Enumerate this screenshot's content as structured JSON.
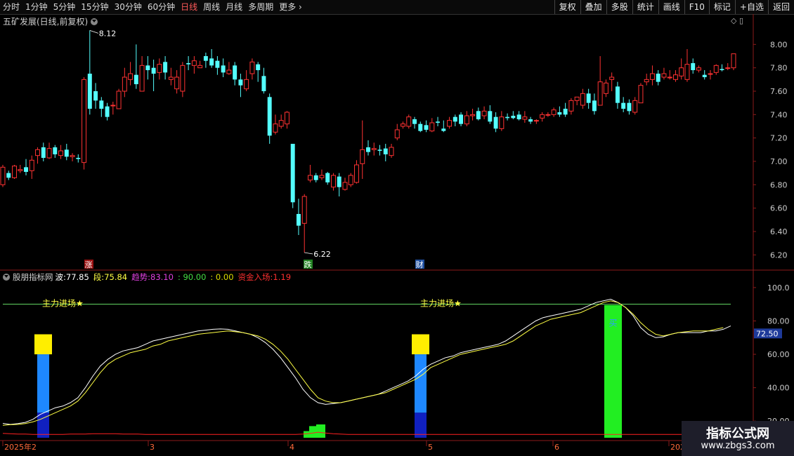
{
  "toolbar": {
    "left_items": [
      "分时",
      "1分钟",
      "5分钟",
      "15分钟",
      "30分钟",
      "60分钟",
      "日线",
      "周线",
      "月线",
      "多周期",
      "更多"
    ],
    "active": "日线",
    "right_buttons": [
      "复权",
      "叠加",
      "多股",
      "统计",
      "画线",
      "F10",
      "标记",
      "+自选",
      "返回"
    ]
  },
  "stock_title": "五矿发展(日线,前复权)",
  "mode_icons": "◇ ▯",
  "indicator": {
    "name": "股朋指标网",
    "bo_label": "波:",
    "bo_value": "77.85",
    "duan_label": "段:",
    "duan_value": "75.84",
    "qushi_label": "趋势:",
    "qushi_value": "83.10",
    "v90": ": 90.00",
    "v0": ": 0.00",
    "zijin_label": "资金入场:",
    "zijin_value": "1.19"
  },
  "logo": {
    "title": "指标公式网",
    "url": "www.zbgs3.com"
  },
  "chart_data": [
    {
      "type": "candlestick",
      "title": "五矿发展(日线,前复权)",
      "ylim": [
        6.1,
        8.2
      ],
      "yticks": [
        "8.00",
        "7.80",
        "7.60",
        "7.40",
        "7.20",
        "7.00",
        "6.80",
        "6.60",
        "6.40",
        "6.20"
      ],
      "yvalues": [
        8.0,
        7.8,
        7.6,
        7.4,
        7.2,
        7.0,
        6.8,
        6.6,
        6.4,
        6.2
      ],
      "annotations": {
        "high": "8.12",
        "low": "6.22"
      },
      "markers": [
        "涨",
        "跌",
        "财"
      ],
      "candles": [
        [
          6.8,
          6.95,
          6.78,
          6.97
        ],
        [
          6.9,
          6.86,
          6.84,
          6.92
        ],
        [
          6.86,
          6.96,
          6.85,
          6.97
        ],
        [
          6.92,
          6.93,
          6.9,
          6.97
        ],
        [
          6.95,
          6.91,
          6.88,
          7.02
        ],
        [
          6.92,
          7.01,
          6.85,
          7.05
        ],
        [
          7.05,
          7.1,
          6.98,
          7.12
        ],
        [
          7.12,
          7.03,
          7.0,
          7.16
        ],
        [
          7.03,
          7.11,
          7.02,
          7.16
        ],
        [
          7.12,
          7.06,
          7.03,
          7.14
        ],
        [
          7.05,
          7.09,
          7.02,
          7.14
        ],
        [
          7.1,
          7.04,
          7.01,
          7.15
        ],
        [
          7.04,
          7.05,
          7.0,
          7.07
        ],
        [
          7.03,
          7.02,
          6.99,
          7.06
        ],
        [
          6.99,
          7.7,
          6.93,
          7.72
        ],
        [
          7.75,
          7.45,
          7.4,
          8.12
        ],
        [
          7.6,
          7.52,
          7.45,
          7.67
        ],
        [
          7.52,
          7.45,
          7.38,
          7.55
        ],
        [
          7.47,
          7.38,
          7.35,
          7.5
        ],
        [
          7.48,
          7.48,
          7.4,
          7.51
        ],
        [
          7.45,
          7.6,
          7.45,
          7.62
        ],
        [
          7.6,
          7.72,
          7.55,
          7.8
        ],
        [
          7.7,
          7.75,
          7.65,
          7.85
        ],
        [
          7.74,
          7.66,
          7.62,
          8.0
        ],
        [
          7.6,
          7.82,
          7.6,
          7.9
        ],
        [
          7.82,
          7.78,
          7.7,
          7.9
        ],
        [
          7.8,
          7.75,
          7.6,
          7.87
        ],
        [
          7.76,
          7.83,
          7.7,
          7.88
        ],
        [
          7.85,
          7.76,
          7.7,
          7.9
        ],
        [
          7.7,
          7.72,
          7.65,
          7.8
        ],
        [
          7.62,
          7.72,
          7.58,
          7.78
        ],
        [
          7.6,
          7.82,
          7.55,
          7.85
        ],
        [
          7.84,
          7.83,
          7.78,
          7.9
        ],
        [
          7.82,
          7.86,
          7.75,
          7.9
        ],
        [
          7.8,
          7.82,
          7.8,
          7.86
        ],
        [
          7.9,
          7.86,
          7.8,
          7.93
        ],
        [
          7.88,
          7.82,
          7.8,
          7.96
        ],
        [
          7.86,
          7.8,
          7.74,
          7.9
        ],
        [
          7.82,
          7.76,
          7.72,
          7.88
        ],
        [
          7.75,
          7.78,
          7.74,
          7.85
        ],
        [
          7.82,
          7.7,
          7.65,
          7.85
        ],
        [
          7.7,
          7.65,
          7.55,
          7.75
        ],
        [
          7.62,
          7.7,
          7.6,
          7.78
        ],
        [
          7.75,
          7.85,
          7.7,
          7.88
        ],
        [
          7.83,
          7.78,
          7.68,
          7.85
        ],
        [
          7.73,
          7.6,
          7.58,
          7.8
        ],
        [
          7.55,
          7.22,
          7.15,
          7.58
        ],
        [
          7.25,
          7.32,
          7.23,
          7.4
        ],
        [
          7.3,
          7.35,
          7.28,
          7.4
        ],
        [
          7.32,
          7.42,
          7.28,
          7.43
        ],
        [
          7.15,
          6.65,
          6.6,
          7.15
        ],
        [
          6.55,
          6.45,
          6.37,
          6.68
        ],
        [
          6.47,
          6.7,
          6.22,
          6.72
        ],
        [
          6.84,
          6.88,
          6.82,
          6.97
        ],
        [
          6.88,
          6.84,
          6.82,
          6.9
        ],
        [
          6.86,
          6.88,
          6.84,
          6.93
        ],
        [
          6.9,
          6.82,
          6.8,
          6.91
        ],
        [
          6.78,
          6.88,
          6.75,
          6.9
        ],
        [
          6.87,
          6.78,
          6.7,
          6.9
        ],
        [
          6.76,
          6.82,
          6.75,
          6.86
        ],
        [
          6.8,
          6.88,
          6.78,
          6.9
        ],
        [
          6.82,
          6.97,
          6.81,
          7.01
        ],
        [
          6.98,
          7.1,
          6.85,
          7.35
        ],
        [
          7.12,
          7.08,
          7.05,
          7.18
        ],
        [
          7.1,
          7.11,
          7.05,
          7.16
        ],
        [
          7.1,
          7.09,
          7.05,
          7.14
        ],
        [
          7.11,
          7.06,
          7.0,
          7.15
        ],
        [
          7.05,
          7.12,
          7.03,
          7.15
        ],
        [
          7.2,
          7.27,
          7.18,
          7.32
        ],
        [
          7.3,
          7.32,
          7.28,
          7.34
        ],
        [
          7.3,
          7.38,
          7.28,
          7.4
        ],
        [
          7.36,
          7.32,
          7.28,
          7.38
        ],
        [
          7.32,
          7.26,
          7.25,
          7.34
        ],
        [
          7.31,
          7.27,
          7.25,
          7.35
        ],
        [
          7.26,
          7.33,
          7.25,
          7.37
        ],
        [
          7.34,
          7.33,
          7.3,
          7.38
        ],
        [
          7.28,
          7.26,
          7.25,
          7.35
        ],
        [
          7.3,
          7.35,
          7.28,
          7.38
        ],
        [
          7.38,
          7.34,
          7.3,
          7.4
        ],
        [
          7.4,
          7.32,
          7.3,
          7.42
        ],
        [
          7.32,
          7.39,
          7.3,
          7.43
        ],
        [
          7.39,
          7.4,
          7.35,
          7.45
        ],
        [
          7.43,
          7.36,
          7.35,
          7.46
        ],
        [
          7.39,
          7.43,
          7.36,
          7.47
        ],
        [
          7.43,
          7.34,
          7.32,
          7.48
        ],
        [
          7.38,
          7.28,
          7.25,
          7.42
        ],
        [
          7.28,
          7.38,
          7.26,
          7.43
        ],
        [
          7.38,
          7.37,
          7.35,
          7.41
        ],
        [
          7.39,
          7.37,
          7.36,
          7.43
        ],
        [
          7.4,
          7.36,
          7.35,
          7.43
        ],
        [
          7.36,
          7.38,
          7.33,
          7.43
        ],
        [
          7.36,
          7.34,
          7.32,
          7.38
        ],
        [
          7.35,
          7.35,
          7.32,
          7.36
        ],
        [
          7.37,
          7.4,
          7.34,
          7.42
        ],
        [
          7.4,
          7.4,
          7.38,
          7.42
        ],
        [
          7.4,
          7.44,
          7.38,
          7.46
        ],
        [
          7.42,
          7.4,
          7.38,
          7.47
        ],
        [
          7.45,
          7.4,
          7.38,
          7.5
        ],
        [
          7.43,
          7.52,
          7.4,
          7.54
        ],
        [
          7.52,
          7.55,
          7.48,
          7.55
        ],
        [
          7.48,
          7.58,
          7.45,
          7.62
        ],
        [
          7.58,
          7.5,
          7.45,
          7.62
        ],
        [
          7.52,
          7.43,
          7.4,
          7.58
        ],
        [
          7.48,
          7.68,
          7.48,
          7.9
        ],
        [
          7.58,
          7.67,
          7.55,
          7.7
        ],
        [
          7.7,
          7.72,
          7.6,
          7.76
        ],
        [
          7.64,
          7.5,
          7.45,
          7.68
        ],
        [
          7.5,
          7.45,
          7.42,
          7.55
        ],
        [
          7.5,
          7.43,
          7.4,
          7.53
        ],
        [
          7.42,
          7.52,
          7.4,
          7.55
        ],
        [
          7.5,
          7.65,
          7.5,
          7.67
        ],
        [
          7.68,
          7.7,
          7.65,
          7.75
        ],
        [
          7.7,
          7.75,
          7.65,
          7.82
        ],
        [
          7.75,
          7.68,
          7.65,
          7.78
        ],
        [
          7.72,
          7.75,
          7.7,
          7.8
        ],
        [
          7.72,
          7.72,
          7.7,
          7.78
        ],
        [
          7.7,
          7.74,
          7.68,
          7.78
        ],
        [
          7.73,
          7.8,
          7.7,
          7.88
        ],
        [
          7.7,
          7.83,
          7.68,
          7.96
        ],
        [
          7.84,
          7.78,
          7.75,
          7.88
        ],
        [
          7.78,
          7.8,
          7.76,
          7.82
        ],
        [
          7.74,
          7.72,
          7.7,
          7.78
        ],
        [
          7.75,
          7.75,
          7.7,
          7.78
        ],
        [
          7.76,
          7.82,
          7.74,
          7.83
        ],
        [
          7.79,
          7.78,
          7.77,
          7.83
        ],
        [
          7.8,
          7.8,
          7.78,
          7.84
        ],
        [
          7.8,
          7.92,
          7.78,
          7.92
        ]
      ]
    },
    {
      "type": "line",
      "title": "股朋指标网",
      "ylim": [
        10,
        105
      ],
      "yticks": [
        "100.0",
        "80.00",
        "60.00",
        "40.00",
        "20.00"
      ],
      "yvalues": [
        100,
        80,
        60,
        40,
        20
      ],
      "current_label": "72.50",
      "series": [
        {
          "name": "波",
          "color": "#ffffff",
          "values": [
            18.6,
            18.0,
            18.5,
            19.2,
            21,
            24,
            26,
            28,
            29,
            31,
            34,
            40,
            47,
            53,
            57,
            60,
            62,
            63,
            64,
            66,
            68,
            69,
            70,
            71,
            72,
            73,
            74,
            74.5,
            75,
            75.2,
            75,
            74,
            73,
            72,
            70,
            67,
            63,
            58,
            52,
            46,
            39,
            34,
            31,
            30,
            30.5,
            31,
            32,
            33,
            34,
            35,
            36,
            38,
            40,
            42,
            44,
            47,
            51,
            54,
            56,
            58,
            59,
            61,
            62,
            63,
            64,
            65,
            66,
            68,
            71,
            74,
            77,
            80,
            82,
            83,
            84,
            85,
            86,
            87,
            89,
            91,
            92,
            93,
            91,
            88,
            83,
            76,
            72,
            70,
            70.5,
            72,
            73,
            73,
            73,
            73,
            74,
            74,
            75,
            77
          ]
        },
        {
          "name": "段",
          "color": "#ffff44",
          "values": [
            17.5,
            17.8,
            18,
            18.5,
            19.5,
            21,
            23,
            25,
            27,
            29,
            32,
            37,
            43,
            49,
            54,
            57,
            59,
            61,
            62,
            63,
            65,
            66,
            68,
            69,
            70,
            71,
            72,
            72.5,
            73,
            73.5,
            74,
            73.5,
            73,
            72,
            71,
            69,
            66,
            62,
            57,
            51,
            45,
            39,
            34,
            32,
            31,
            31,
            32,
            33,
            34,
            35,
            36,
            37,
            39,
            41,
            43,
            45,
            48,
            52,
            54,
            56,
            58,
            60,
            61,
            62,
            63,
            64,
            65,
            66,
            68,
            71,
            74,
            77,
            79,
            81,
            82,
            83,
            84,
            85,
            87,
            89,
            91,
            92,
            91,
            88,
            84,
            79,
            75,
            72,
            71,
            72,
            73,
            73.5,
            74,
            74,
            74,
            75,
            76
          ]
        },
        {
          "name": "资金入场",
          "color": "#ff2020",
          "values": [
            1.2,
            1.1,
            1.0,
            1.0,
            0.9,
            0.9,
            0.9,
            0.9,
            0.9,
            1.0,
            1.0,
            1.0,
            1.1,
            1.1,
            1.1,
            1.1,
            1.0,
            1.0,
            1.0,
            0.9,
            0.9,
            0.9,
            0.9,
            0.9,
            0.9,
            0.9,
            0.9,
            0.9,
            0.9,
            0.9,
            0.9,
            0.9,
            0.9,
            0.9,
            0.9,
            0.9,
            0.9,
            0.9,
            0.9,
            0.9,
            1.0,
            1.2,
            1.5,
            1.3,
            1.1,
            1.0,
            0.9,
            0.9,
            0.9,
            0.9,
            0.9,
            0.9,
            0.9,
            0.9,
            0.9,
            0.9,
            0.9,
            0.9,
            0.9,
            0.9,
            0.9,
            0.9,
            0.9,
            0.9,
            0.9,
            0.9,
            0.9,
            0.9,
            0.9,
            0.9,
            0.9,
            0.9,
            0.9,
            0.9,
            0.9,
            0.9,
            0.9,
            0.9,
            0.9,
            0.9,
            0.9,
            0.9,
            0.9,
            0.9,
            0.9,
            0.9,
            0.9,
            0.9,
            0.9,
            0.9,
            0.9,
            0.9,
            0.9,
            1.0,
            1.19
          ]
        }
      ],
      "horizontal_line": {
        "value": 90,
        "color": "#66dd66"
      },
      "text_annotations": [
        "主力进场★",
        "主力进场★"
      ],
      "bar_label": "买",
      "x_labels": [
        "2025年2",
        "3",
        "4",
        "5",
        "6",
        "202"
      ]
    }
  ]
}
